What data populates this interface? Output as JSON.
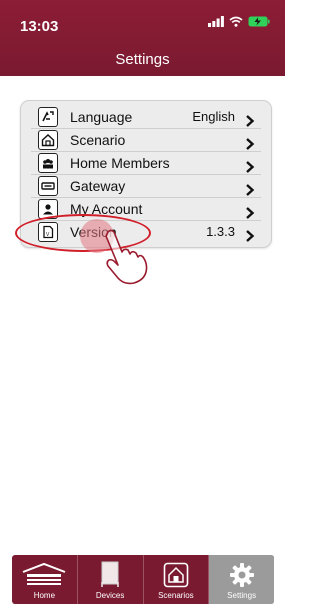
{
  "status_bar": {
    "time": "13:03"
  },
  "header": {
    "title": "Settings"
  },
  "settings": {
    "items": [
      {
        "label": "Language",
        "value": "English",
        "icon": "language-icon"
      },
      {
        "label": "Scenario",
        "value": "",
        "icon": "scenario-icon"
      },
      {
        "label": "Home Members",
        "value": "",
        "icon": "home-members-icon"
      },
      {
        "label": "Gateway",
        "value": "",
        "icon": "gateway-icon"
      },
      {
        "label": "My Account",
        "value": "",
        "icon": "account-icon"
      },
      {
        "label": "Version",
        "value": "1.3.3",
        "icon": "version-icon"
      }
    ]
  },
  "tabbar": {
    "tabs": [
      {
        "label": "Home",
        "icon": "home-icon"
      },
      {
        "label": "Devices",
        "icon": "devices-icon"
      },
      {
        "label": "Scenarios",
        "icon": "scenarios-icon"
      },
      {
        "label": "Settings",
        "icon": "gear-icon",
        "active": true
      }
    ]
  },
  "colors": {
    "brand": "#7a1a30",
    "highlight": "#d11f2a",
    "active_tab": "#9b9b9b"
  }
}
